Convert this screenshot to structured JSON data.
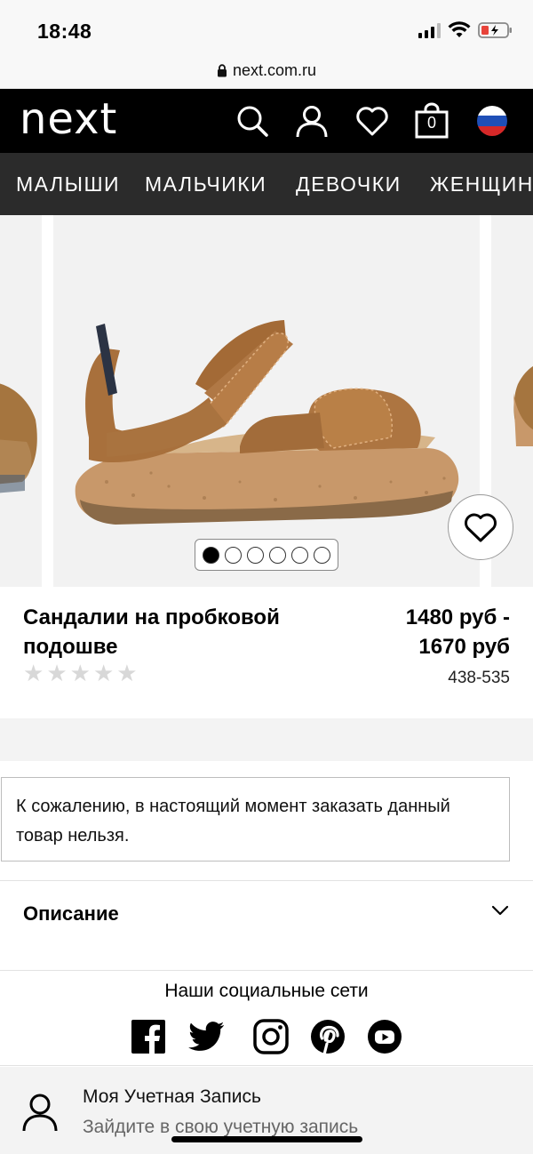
{
  "status_bar": {
    "time": "18:48"
  },
  "browser": {
    "url": "next.com.ru"
  },
  "header": {
    "logo": "next",
    "bag_count": "0"
  },
  "nav": {
    "items": [
      "МАЛЫШИ",
      "МАЛЬЧИКИ",
      "ДЕВОЧКИ",
      "ЖЕНЩИН"
    ]
  },
  "gallery": {
    "total_images": 6,
    "active_index": 0
  },
  "product": {
    "title": "Сандалии на пробковой подошве",
    "price": "1480 руб -\n1670 руб",
    "sku": "438-535",
    "rating_stars": 5,
    "rating_filled": 0
  },
  "notice": {
    "text": "К сожалению, в настоящий момент заказать данный товар нельзя."
  },
  "description": {
    "label": "Описание"
  },
  "social": {
    "title": "Наши социальные сети",
    "icons": [
      "facebook-icon",
      "twitter-icon",
      "instagram-icon",
      "pinterest-icon",
      "youtube-icon"
    ]
  },
  "account": {
    "title": "Моя Учетная Запись",
    "subtitle": "Зайдите в свою учетную запись"
  },
  "colors": {
    "header_bg": "#000000",
    "nav_bg": "#2b2b2b",
    "accent": "#000000",
    "star_empty": "#d8d8d8"
  }
}
